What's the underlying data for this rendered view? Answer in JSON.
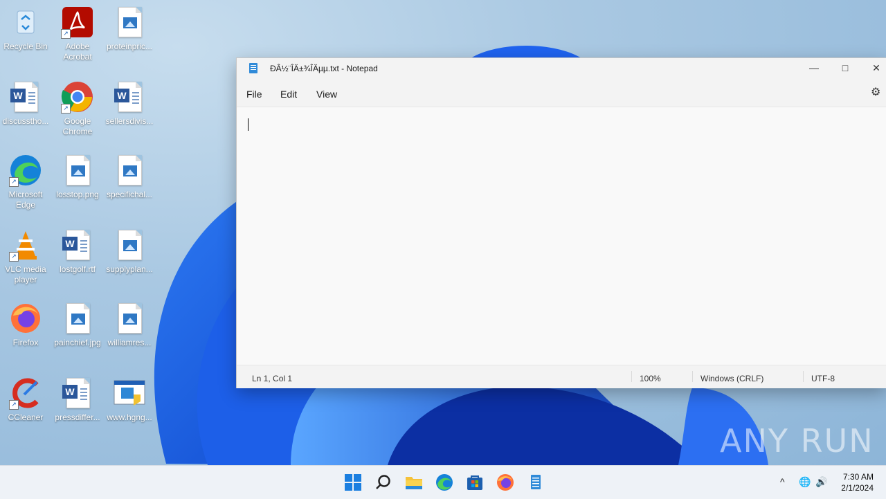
{
  "desktop": {
    "icons": [
      {
        "label": "Recycle Bin"
      },
      {
        "label": "Adobe Acrobat"
      },
      {
        "label": "proteinpric..."
      },
      {
        "label": "discusstho..."
      },
      {
        "label": "Google Chrome"
      },
      {
        "label": "sellersdivis..."
      },
      {
        "label": "Microsoft Edge"
      },
      {
        "label": "losstop.png"
      },
      {
        "label": "specifichal..."
      },
      {
        "label": "VLC media player"
      },
      {
        "label": "lostgolf.rtf"
      },
      {
        "label": "supplyplan..."
      },
      {
        "label": "Firefox"
      },
      {
        "label": "painchief.jpg"
      },
      {
        "label": "williamres..."
      },
      {
        "label": "CCleaner"
      },
      {
        "label": "pressdiffer..."
      },
      {
        "label": "www.hgng..."
      }
    ]
  },
  "notepad": {
    "title": "ÐÂ½¨ÎÄ±¾ÎÄµµ.txt - Notepad",
    "menu": [
      "File",
      "Edit",
      "View"
    ],
    "status": {
      "position": "Ln 1, Col 1",
      "zoom": "100%",
      "line_ending": "Windows (CRLF)",
      "encoding": "UTF-8"
    }
  },
  "taskbar": {
    "icons": [
      "start-icon",
      "search-icon",
      "file-explorer-icon",
      "edge-icon",
      "store-icon",
      "firefox-icon",
      "notepad-icon"
    ],
    "clock": {
      "time": "7:30 AM",
      "date": "2/1/2024"
    }
  },
  "watermark": "ANY RUN"
}
